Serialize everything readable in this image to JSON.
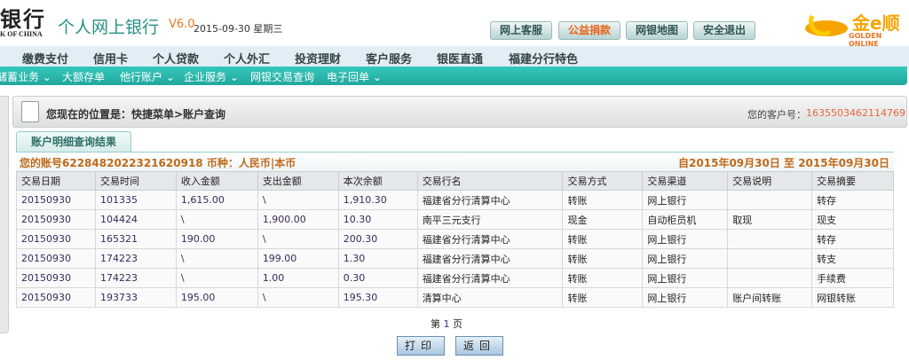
{
  "header": {
    "logo_cn": "银行",
    "logo_en": "K OF CHINA",
    "title": "个人网上银行",
    "version": "V6.0",
    "date": "2015-09-30 星期三",
    "buttons": [
      {
        "label": "网上客服",
        "color": "#355555"
      },
      {
        "label": "公益捐款",
        "color": "#e8661a"
      },
      {
        "label": "网银地图",
        "color": "#355555"
      },
      {
        "label": "安全退出",
        "color": "#355555"
      }
    ],
    "partner_logo": {
      "cn": "金e顺",
      "en": "GOLDEN ONLINE"
    }
  },
  "nav": [
    "缴费支付",
    "信用卡",
    "个人贷款",
    "个人外汇",
    "投资理财",
    "客户服务",
    "银医直通",
    "福建分行特色"
  ],
  "subnav": [
    "储蓄业务 ⌄",
    "大额存单",
    "他行账户 ⌄",
    "企业服务 ⌄",
    "网银交易查询",
    "电子回单 ⌄"
  ],
  "breadcrumb": {
    "text": "您现在的位置是：快捷菜单>账户查询",
    "customer_label": "您的客户号：",
    "customer_no": "1635503462114769"
  },
  "tab": "账户明细查询结果",
  "account": {
    "info": "您的账号6228482022321620918 币种：人民币|本币",
    "range": "自2015年09月30日  至  2015年09月30日"
  },
  "table": {
    "headers": [
      "交易日期",
      "交易时间",
      "收入金额",
      "支出金额",
      "本次余额",
      "交易行名",
      "交易方式",
      "交易渠道",
      "交易说明",
      "交易摘要"
    ],
    "rows": [
      [
        "20150930",
        "101335",
        "1,615.00",
        "\\",
        "1,910.30",
        "福建省分行清算中心",
        "转账",
        "网上银行",
        "",
        "转存"
      ],
      [
        "20150930",
        "104424",
        "\\",
        "1,900.00",
        "10.30",
        "南平三元支行",
        "现金",
        "自动柜员机",
        "取现",
        "现支"
      ],
      [
        "20150930",
        "165321",
        "190.00",
        "\\",
        "200.30",
        "福建省分行清算中心",
        "转账",
        "网上银行",
        "",
        "转存"
      ],
      [
        "20150930",
        "174223",
        "\\",
        "199.00",
        "1.30",
        "福建省分行清算中心",
        "转账",
        "网上银行",
        "",
        "转支"
      ],
      [
        "20150930",
        "174223",
        "\\",
        "1.00",
        "0.30",
        "福建省分行清算中心",
        "转账",
        "网上银行",
        "",
        "手续费"
      ],
      [
        "20150930",
        "193733",
        "195.00",
        "\\",
        "195.30",
        "清算中心",
        "转账",
        "网上银行",
        "账户间转账",
        "网银转账"
      ]
    ]
  },
  "pagination": {
    "prefix": "第",
    "page": "1",
    "suffix": "页"
  },
  "actions": {
    "print": "打印",
    "back": "返回"
  }
}
